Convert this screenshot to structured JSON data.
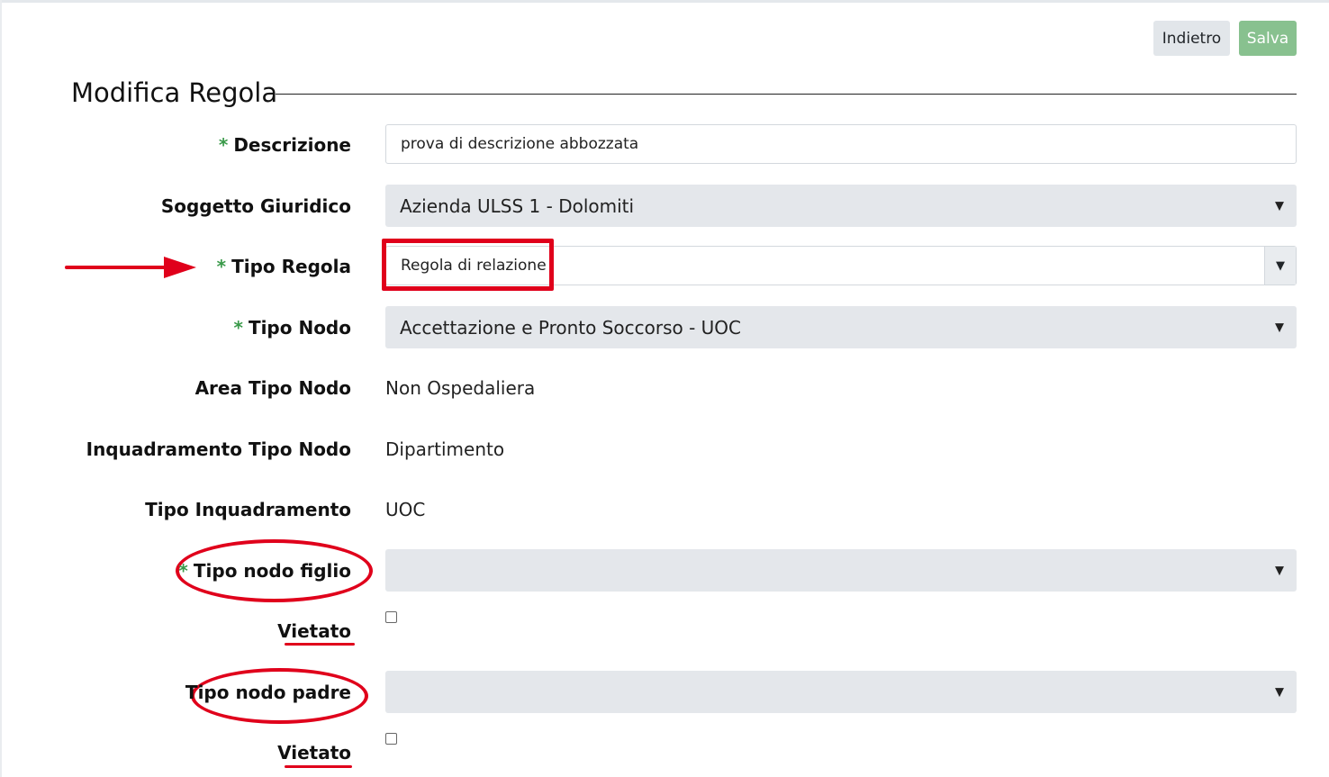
{
  "toolbar": {
    "back_label": "Indietro",
    "save_label": "Salva"
  },
  "page": {
    "title": "Modifica Regola"
  },
  "form": {
    "required_marker": "*",
    "descrizione": {
      "label": "Descrizione",
      "value": "prova di descrizione abbozzata"
    },
    "soggetto_giuridico": {
      "label": "Soggetto Giuridico",
      "value": "Azienda ULSS 1 - Dolomiti"
    },
    "tipo_regola": {
      "label": "Tipo Regola",
      "value": "Regola di relazione"
    },
    "tipo_nodo": {
      "label": "Tipo Nodo",
      "value": "Accettazione e Pronto Soccorso - UOC"
    },
    "area_tipo_nodo": {
      "label": "Area Tipo Nodo",
      "value": "Non Ospedaliera"
    },
    "inquadramento_tipo_nodo": {
      "label": "Inquadramento Tipo Nodo",
      "value": "Dipartimento"
    },
    "tipo_inquadramento": {
      "label": "Tipo Inquadramento",
      "value": "UOC"
    },
    "tipo_nodo_figlio": {
      "label": "Tipo nodo figlio",
      "value": ""
    },
    "vietato_figlio": {
      "label": "Vietato",
      "checked": false
    },
    "tipo_nodo_padre": {
      "label": "Tipo nodo padre",
      "value": ""
    },
    "vietato_padre": {
      "label": "Vietato",
      "checked": false
    }
  },
  "icons": {
    "caret": "▼"
  },
  "colors": {
    "annotation": "#e0001b",
    "save_button": "#88c18f",
    "required": "#3a9a4a"
  }
}
